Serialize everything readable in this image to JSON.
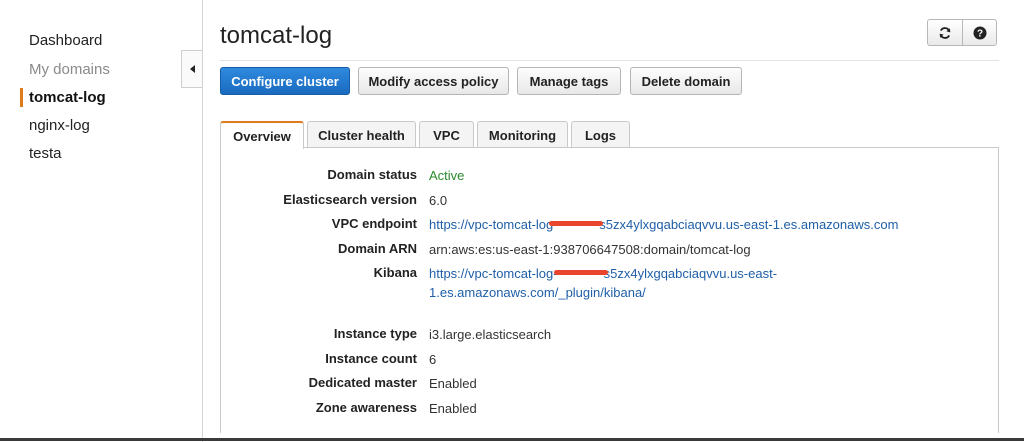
{
  "sidebar": {
    "items": [
      {
        "label": "Dashboard"
      },
      {
        "label": "My domains"
      },
      {
        "label": "tomcat-log"
      },
      {
        "label": "nginx-log"
      },
      {
        "label": "testa"
      }
    ]
  },
  "header": {
    "title": "tomcat-log",
    "icons": [
      "refresh-icon",
      "help-icon"
    ]
  },
  "actions": {
    "configure": "Configure cluster",
    "modify_policy": "Modify access policy",
    "manage_tags": "Manage tags",
    "delete": "Delete domain"
  },
  "tabs": [
    {
      "label": "Overview"
    },
    {
      "label": "Cluster health"
    },
    {
      "label": "VPC"
    },
    {
      "label": "Monitoring"
    },
    {
      "label": "Logs"
    }
  ],
  "overview": {
    "domain_status": {
      "label": "Domain status",
      "value": "Active"
    },
    "es_version": {
      "label": "Elasticsearch version",
      "value": "6.0"
    },
    "vpc_endpoint": {
      "label": "VPC endpoint",
      "prefix": "https://vpc-tomcat-log",
      "suffix": "s5zx4ylxgqabciaqvvu.us-east-1.es.amazonaws.com"
    },
    "domain_arn": {
      "label": "Domain ARN",
      "value": "arn:aws:es:us-east-1:938706647508:domain/tomcat-log"
    },
    "kibana": {
      "label": "Kibana",
      "prefix": "https://vpc-tomcat-log-",
      "suffix": "s5zx4ylxgqabciaqvvu.us-east-",
      "line2": "1.es.amazonaws.com/_plugin/kibana/"
    },
    "instance_type": {
      "label": "Instance type",
      "value": "i3.large.elasticsearch"
    },
    "instance_count": {
      "label": "Instance count",
      "value": "6"
    },
    "dedicated_master": {
      "label": "Dedicated master",
      "value": "Enabled"
    },
    "zone_awareness": {
      "label": "Zone awareness",
      "value": "Enabled"
    }
  },
  "colors": {
    "accent": "#e07a1f",
    "primary": "#1a6bc0",
    "link": "#1f5fa8",
    "status_green": "#2a8a2a"
  }
}
